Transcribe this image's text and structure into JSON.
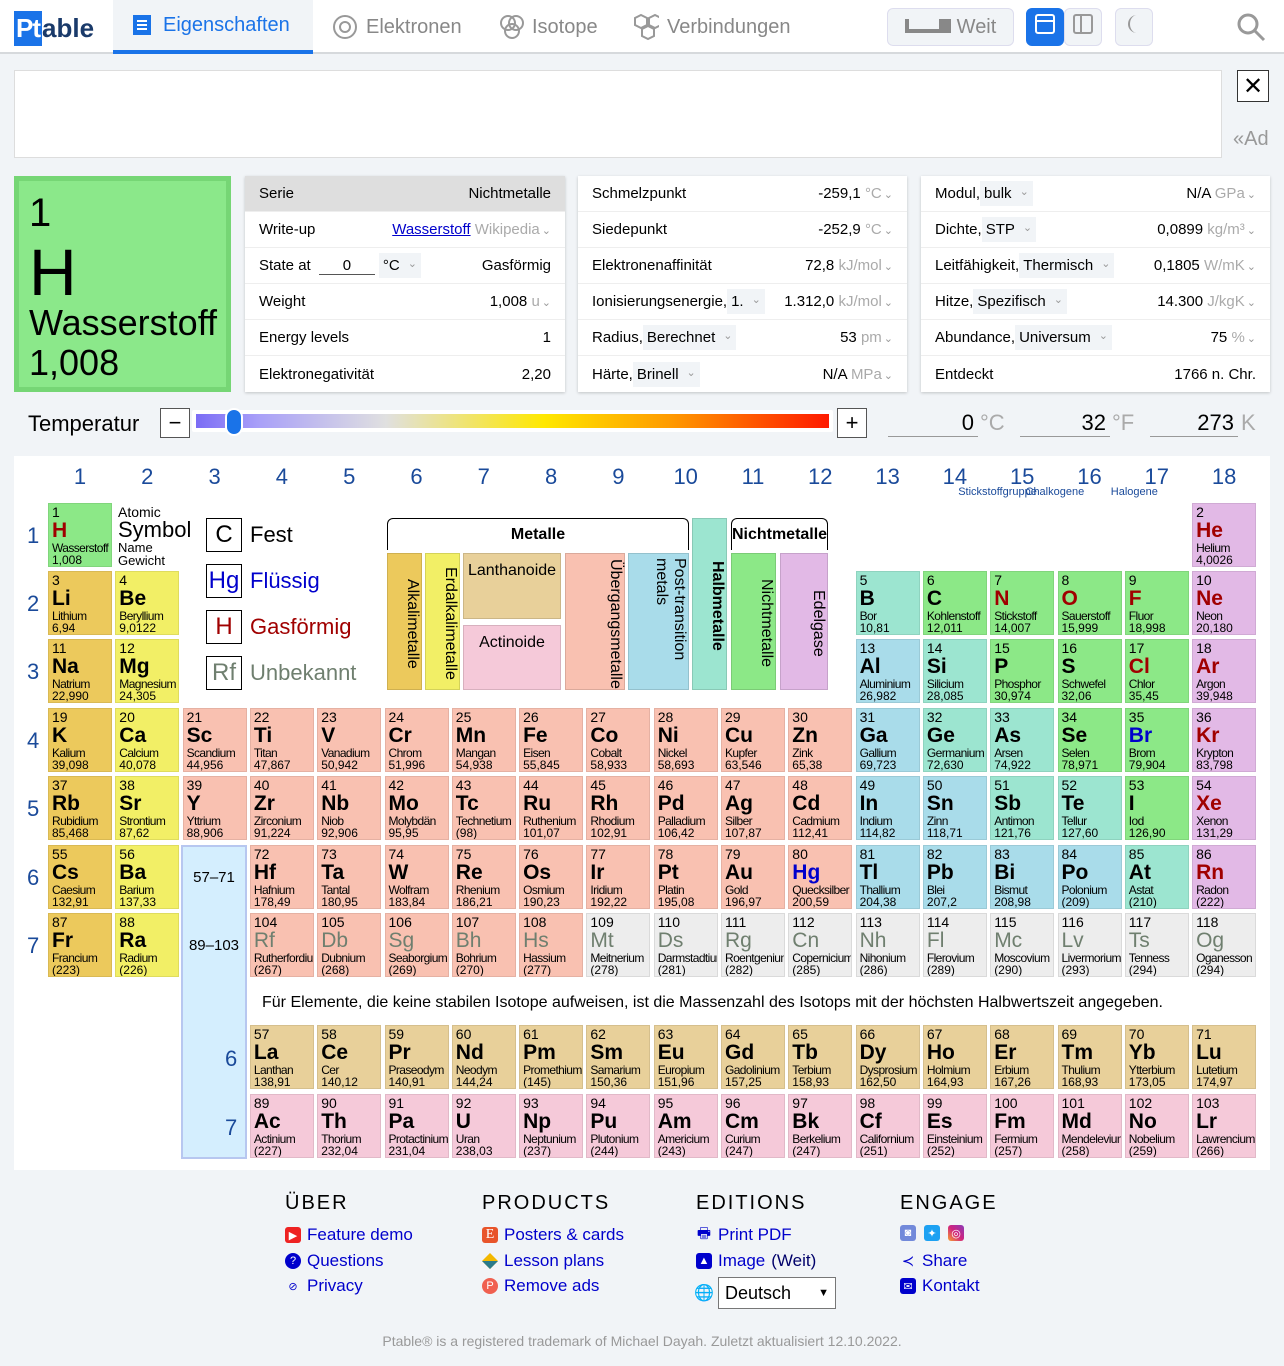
{
  "header": {
    "logo_a": "Pt",
    "logo_b": "able",
    "tabs": [
      "Eigenschaften",
      "Elektronen",
      "Isotope",
      "Verbindungen"
    ],
    "wide_label": "Weit"
  },
  "ad": {
    "close": "✕",
    "label": "«Ad"
  },
  "selected": {
    "number": "1",
    "symbol": "H",
    "name": "Wasserstoff",
    "weight": "1,008"
  },
  "panel1": [
    {
      "label": "Serie",
      "value": "Nichtmetalle"
    },
    {
      "label": "Write-up",
      "link": "Wasserstoff",
      "source": "Wikipedia"
    },
    {
      "label": "State at",
      "input": "0",
      "unit": "°C",
      "value": "Gasförmig"
    },
    {
      "label": "Weight",
      "value": "1,008",
      "unit": "u"
    },
    {
      "label": "Energy levels",
      "value": "1"
    },
    {
      "label": "Elektronegativität",
      "value": "2,20"
    }
  ],
  "panel2": [
    {
      "label": "Schmelzpunkt",
      "value": "-259,1",
      "unit": "°C"
    },
    {
      "label": "Siedepunkt",
      "value": "-252,9",
      "unit": "°C"
    },
    {
      "label": "Elektronenaffinität",
      "value": "72,8",
      "unit": "kJ/mol"
    },
    {
      "label": "Ionisierungsenergie,",
      "select": "1.",
      "value": "1.312,0",
      "unit": "kJ/mol"
    },
    {
      "label": "Radius,",
      "select": "Berechnet",
      "value": "53",
      "unit": "pm"
    },
    {
      "label": "Härte,",
      "select": "Brinell",
      "value": "N/A",
      "unit": "MPa"
    }
  ],
  "panel3": [
    {
      "label": "Modul,",
      "select": "bulk",
      "value": "N/A",
      "unit": "GPa"
    },
    {
      "label": "Dichte,",
      "select": "STP",
      "value": "0,0899",
      "unit": "kg/m³"
    },
    {
      "label": "Leitfähigkeit,",
      "select": "Thermisch",
      "value": "0,1805",
      "unit": "W/mK"
    },
    {
      "label": "Hitze,",
      "select": "Spezifisch",
      "value": "14.300",
      "unit": "J/kgK"
    },
    {
      "label": "Abundance,",
      "select": "Universum",
      "value": "75",
      "unit": "%"
    },
    {
      "label": "Entdeckt",
      "value": "1766 n. Chr."
    }
  ],
  "temperature": {
    "label": "Temperatur",
    "minus": "−",
    "plus": "+",
    "slider_fraction": 0.06,
    "celsius": "0",
    "c_unit": "°C",
    "fahrenheit": "32",
    "f_unit": "°F",
    "kelvin": "273",
    "k_unit": "K"
  },
  "table": {
    "groups": [
      "1",
      "2",
      "3",
      "4",
      "5",
      "6",
      "7",
      "8",
      "9",
      "10",
      "11",
      "12",
      "13",
      "14",
      "15",
      "16",
      "17",
      "18"
    ],
    "group_names": {
      "15": "Stickstoffgruppe",
      "16": "Chalkogene",
      "17": "Halogene"
    },
    "periods": [
      "1",
      "2",
      "3",
      "4",
      "5",
      "6",
      "7"
    ],
    "lanth_ref": "57–71",
    "act_ref": "89–103",
    "lanth_period": "6",
    "act_period": "7",
    "key": {
      "atomic": "Atomic",
      "symbol": "Symbol",
      "name": "Name",
      "weight": "Gewicht"
    },
    "states": [
      {
        "sym": "C",
        "label": "Fest",
        "color": "#000000"
      },
      {
        "sym": "Hg",
        "label": "Flüssig",
        "color": "#0000cc"
      },
      {
        "sym": "H",
        "label": "Gasförmig",
        "color": "#a00000"
      },
      {
        "sym": "Rf",
        "label": "Unbekannt",
        "color": "#6f7f6f"
      }
    ],
    "categories": {
      "metals": "Metalle",
      "nonmetals": "Nichtmetalle",
      "alkali": "Alkalimetalle",
      "alkaline": "Erdalkalimetalle",
      "lanthanide": "Lanthanoide",
      "actinide": "Actinoide",
      "transition": "Übergangsmetalle",
      "post": "Post-transition metals",
      "metalloid": "Halbmetalle",
      "nonmetal": "Nichtmetalle",
      "noble": "Edelgase"
    },
    "colors": {
      "alkali": "#ecc95c",
      "alkaline": "#f2ef66",
      "transition": "#f9c1b1",
      "post": "#a9dcea",
      "metalloid": "#9ce5d0",
      "nonmetal": "#8ce887",
      "noble": "#e2b9e6",
      "lanthanide": "#e8d09a",
      "actinide": "#f5c9d9",
      "unknown": "#ededed"
    },
    "note": "Für Elemente, die keine stabilen Isotope aufweisen, ist die Massenzahl des Isotops mit der höchsten Halbwertszeit angegeben.",
    "elements": [
      [
        "H",
        "Wasserstoff",
        "1,008",
        "nonmetal",
        "g"
      ],
      [
        "He",
        "Helium",
        "4,0026",
        "noble",
        "g"
      ],
      [
        "Li",
        "Lithium",
        "6,94",
        "alkali",
        "s"
      ],
      [
        "Be",
        "Beryllium",
        "9,0122",
        "alkaline",
        "s"
      ],
      [
        "B",
        "Bor",
        "10,81",
        "metalloid",
        "s"
      ],
      [
        "C",
        "Kohlenstoff",
        "12,011",
        "nonmetal",
        "s"
      ],
      [
        "N",
        "Stickstoff",
        "14,007",
        "nonmetal",
        "g"
      ],
      [
        "O",
        "Sauerstoff",
        "15,999",
        "nonmetal",
        "g"
      ],
      [
        "F",
        "Fluor",
        "18,998",
        "nonmetal",
        "g"
      ],
      [
        "Ne",
        "Neon",
        "20,180",
        "noble",
        "g"
      ],
      [
        "Na",
        "Natrium",
        "22,990",
        "alkali",
        "s"
      ],
      [
        "Mg",
        "Magnesium",
        "24,305",
        "alkaline",
        "s"
      ],
      [
        "Al",
        "Aluminium",
        "26,982",
        "post",
        "s"
      ],
      [
        "Si",
        "Silicium",
        "28,085",
        "metalloid",
        "s"
      ],
      [
        "P",
        "Phosphor",
        "30,974",
        "nonmetal",
        "s"
      ],
      [
        "S",
        "Schwefel",
        "32,06",
        "nonmetal",
        "s"
      ],
      [
        "Cl",
        "Chlor",
        "35,45",
        "nonmetal",
        "g"
      ],
      [
        "Ar",
        "Argon",
        "39,948",
        "noble",
        "g"
      ],
      [
        "K",
        "Kalium",
        "39,098",
        "alkali",
        "s"
      ],
      [
        "Ca",
        "Calcium",
        "40,078",
        "alkaline",
        "s"
      ],
      [
        "Sc",
        "Scandium",
        "44,956",
        "transition",
        "s"
      ],
      [
        "Ti",
        "Titan",
        "47,867",
        "transition",
        "s"
      ],
      [
        "V",
        "Vanadium",
        "50,942",
        "transition",
        "s"
      ],
      [
        "Cr",
        "Chrom",
        "51,996",
        "transition",
        "s"
      ],
      [
        "Mn",
        "Mangan",
        "54,938",
        "transition",
        "s"
      ],
      [
        "Fe",
        "Eisen",
        "55,845",
        "transition",
        "s"
      ],
      [
        "Co",
        "Cobalt",
        "58,933",
        "transition",
        "s"
      ],
      [
        "Ni",
        "Nickel",
        "58,693",
        "transition",
        "s"
      ],
      [
        "Cu",
        "Kupfer",
        "63,546",
        "transition",
        "s"
      ],
      [
        "Zn",
        "Zink",
        "65,38",
        "transition",
        "s"
      ],
      [
        "Ga",
        "Gallium",
        "69,723",
        "post",
        "s"
      ],
      [
        "Ge",
        "Germanium",
        "72,630",
        "metalloid",
        "s"
      ],
      [
        "As",
        "Arsen",
        "74,922",
        "metalloid",
        "s"
      ],
      [
        "Se",
        "Selen",
        "78,971",
        "nonmetal",
        "s"
      ],
      [
        "Br",
        "Brom",
        "79,904",
        "nonmetal",
        "l"
      ],
      [
        "Kr",
        "Krypton",
        "83,798",
        "noble",
        "g"
      ],
      [
        "Rb",
        "Rubidium",
        "85,468",
        "alkali",
        "s"
      ],
      [
        "Sr",
        "Strontium",
        "87,62",
        "alkaline",
        "s"
      ],
      [
        "Y",
        "Yttrium",
        "88,906",
        "transition",
        "s"
      ],
      [
        "Zr",
        "Zirconium",
        "91,224",
        "transition",
        "s"
      ],
      [
        "Nb",
        "Niob",
        "92,906",
        "transition",
        "s"
      ],
      [
        "Mo",
        "Molybdän",
        "95,95",
        "transition",
        "s"
      ],
      [
        "Tc",
        "Technetium",
        "(98)",
        "transition",
        "s"
      ],
      [
        "Ru",
        "Ruthenium",
        "101,07",
        "transition",
        "s"
      ],
      [
        "Rh",
        "Rhodium",
        "102,91",
        "transition",
        "s"
      ],
      [
        "Pd",
        "Palladium",
        "106,42",
        "transition",
        "s"
      ],
      [
        "Ag",
        "Silber",
        "107,87",
        "transition",
        "s"
      ],
      [
        "Cd",
        "Cadmium",
        "112,41",
        "transition",
        "s"
      ],
      [
        "In",
        "Indium",
        "114,82",
        "post",
        "s"
      ],
      [
        "Sn",
        "Zinn",
        "118,71",
        "post",
        "s"
      ],
      [
        "Sb",
        "Antimon",
        "121,76",
        "metalloid",
        "s"
      ],
      [
        "Te",
        "Tellur",
        "127,60",
        "metalloid",
        "s"
      ],
      [
        "I",
        "Iod",
        "126,90",
        "nonmetal",
        "s"
      ],
      [
        "Xe",
        "Xenon",
        "131,29",
        "noble",
        "g"
      ],
      [
        "Cs",
        "Caesium",
        "132,91",
        "alkali",
        "s"
      ],
      [
        "Ba",
        "Barium",
        "137,33",
        "alkaline",
        "s"
      ],
      [
        "La",
        "Lanthan",
        "138,91",
        "lanthanide",
        "s"
      ],
      [
        "Ce",
        "Cer",
        "140,12",
        "lanthanide",
        "s"
      ],
      [
        "Pr",
        "Praseodym",
        "140,91",
        "lanthanide",
        "s"
      ],
      [
        "Nd",
        "Neodym",
        "144,24",
        "lanthanide",
        "s"
      ],
      [
        "Pm",
        "Promethium",
        "(145)",
        "lanthanide",
        "s"
      ],
      [
        "Sm",
        "Samarium",
        "150,36",
        "lanthanide",
        "s"
      ],
      [
        "Eu",
        "Europium",
        "151,96",
        "lanthanide",
        "s"
      ],
      [
        "Gd",
        "Gadolinium",
        "157,25",
        "lanthanide",
        "s"
      ],
      [
        "Tb",
        "Terbium",
        "158,93",
        "lanthanide",
        "s"
      ],
      [
        "Dy",
        "Dysprosium",
        "162,50",
        "lanthanide",
        "s"
      ],
      [
        "Ho",
        "Holmium",
        "164,93",
        "lanthanide",
        "s"
      ],
      [
        "Er",
        "Erbium",
        "167,26",
        "lanthanide",
        "s"
      ],
      [
        "Tm",
        "Thulium",
        "168,93",
        "lanthanide",
        "s"
      ],
      [
        "Yb",
        "Ytterbium",
        "173,05",
        "lanthanide",
        "s"
      ],
      [
        "Lu",
        "Lutetium",
        "174,97",
        "lanthanide",
        "s"
      ],
      [
        "Hf",
        "Hafnium",
        "178,49",
        "transition",
        "s"
      ],
      [
        "Ta",
        "Tantal",
        "180,95",
        "transition",
        "s"
      ],
      [
        "W",
        "Wolfram",
        "183,84",
        "transition",
        "s"
      ],
      [
        "Re",
        "Rhenium",
        "186,21",
        "transition",
        "s"
      ],
      [
        "Os",
        "Osmium",
        "190,23",
        "transition",
        "s"
      ],
      [
        "Ir",
        "Iridium",
        "192,22",
        "transition",
        "s"
      ],
      [
        "Pt",
        "Platin",
        "195,08",
        "transition",
        "s"
      ],
      [
        "Au",
        "Gold",
        "196,97",
        "transition",
        "s"
      ],
      [
        "Hg",
        "Quecksilber",
        "200,59",
        "transition",
        "l"
      ],
      [
        "Tl",
        "Thallium",
        "204,38",
        "post",
        "s"
      ],
      [
        "Pb",
        "Blei",
        "207,2",
        "post",
        "s"
      ],
      [
        "Bi",
        "Bismut",
        "208,98",
        "post",
        "s"
      ],
      [
        "Po",
        "Polonium",
        "(209)",
        "post",
        "s"
      ],
      [
        "At",
        "Astat",
        "(210)",
        "metalloid",
        "s"
      ],
      [
        "Rn",
        "Radon",
        "(222)",
        "noble",
        "g"
      ],
      [
        "Fr",
        "Francium",
        "(223)",
        "alkali",
        "s"
      ],
      [
        "Ra",
        "Radium",
        "(226)",
        "alkaline",
        "s"
      ],
      [
        "Ac",
        "Actinium",
        "(227)",
        "actinide",
        "s"
      ],
      [
        "Th",
        "Thorium",
        "232,04",
        "actinide",
        "s"
      ],
      [
        "Pa",
        "Protactinium",
        "231,04",
        "actinide",
        "s"
      ],
      [
        "U",
        "Uran",
        "238,03",
        "actinide",
        "s"
      ],
      [
        "Np",
        "Neptunium",
        "(237)",
        "actinide",
        "s"
      ],
      [
        "Pu",
        "Plutonium",
        "(244)",
        "actinide",
        "s"
      ],
      [
        "Am",
        "Americium",
        "(243)",
        "actinide",
        "s"
      ],
      [
        "Cm",
        "Curium",
        "(247)",
        "actinide",
        "s"
      ],
      [
        "Bk",
        "Berkelium",
        "(247)",
        "actinide",
        "s"
      ],
      [
        "Cf",
        "Californium",
        "(251)",
        "actinide",
        "s"
      ],
      [
        "Es",
        "Einsteinium",
        "(252)",
        "actinide",
        "s"
      ],
      [
        "Fm",
        "Fermium",
        "(257)",
        "actinide",
        "s"
      ],
      [
        "Md",
        "Mendelevium",
        "(258)",
        "actinide",
        "s"
      ],
      [
        "No",
        "Nobelium",
        "(259)",
        "actinide",
        "s"
      ],
      [
        "Lr",
        "Lawrencium",
        "(266)",
        "actinide",
        "s"
      ],
      [
        "Rf",
        "Rutherfordium",
        "(267)",
        "transition",
        "u"
      ],
      [
        "Db",
        "Dubnium",
        "(268)",
        "transition",
        "u"
      ],
      [
        "Sg",
        "Seaborgium",
        "(269)",
        "transition",
        "u"
      ],
      [
        "Bh",
        "Bohrium",
        "(270)",
        "transition",
        "u"
      ],
      [
        "Hs",
        "Hassium",
        "(277)",
        "transition",
        "u"
      ],
      [
        "Mt",
        "Meitnerium",
        "(278)",
        "unknown",
        "u"
      ],
      [
        "Ds",
        "Darmstadtium",
        "(281)",
        "unknown",
        "u"
      ],
      [
        "Rg",
        "Roentgenium",
        "(282)",
        "unknown",
        "u"
      ],
      [
        "Cn",
        "Copernicium",
        "(285)",
        "unknown",
        "u"
      ],
      [
        "Nh",
        "Nihonium",
        "(286)",
        "unknown",
        "u"
      ],
      [
        "Fl",
        "Flerovium",
        "(289)",
        "unknown",
        "u"
      ],
      [
        "Mc",
        "Moscovium",
        "(290)",
        "unknown",
        "u"
      ],
      [
        "Lv",
        "Livermorium",
        "(293)",
        "unknown",
        "u"
      ],
      [
        "Ts",
        "Tenness",
        "(294)",
        "unknown",
        "u"
      ],
      [
        "Og",
        "Oganesson",
        "(294)",
        "unknown",
        "u"
      ]
    ]
  },
  "footer": {
    "cols": [
      {
        "title": "ÜBER",
        "items": [
          "Feature demo",
          "Questions",
          "Privacy"
        ]
      },
      {
        "title": "PRODUCTS",
        "items": [
          "Posters & cards",
          "Lesson plans",
          "Remove ads"
        ]
      },
      {
        "title": "EDITIONS",
        "items": [
          "Print PDF",
          "Image",
          "(Weit)"
        ]
      },
      {
        "title": "ENGAGE",
        "items": [
          "Share",
          "Kontakt"
        ]
      }
    ],
    "language": "Deutsch",
    "copyright": "Ptable® is a registered trademark of Michael Dayah. Zuletzt aktualisiert 12.10.2022."
  }
}
